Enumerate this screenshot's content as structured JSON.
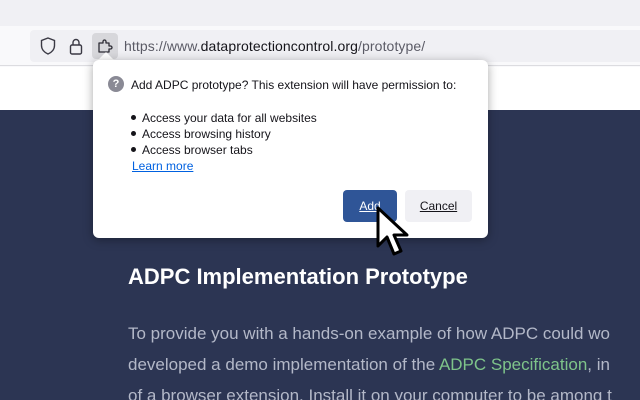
{
  "browser": {
    "url_scheme": "https://www.",
    "url_host": "dataprotectioncontrol.org",
    "url_path": "/prototype/"
  },
  "page": {
    "heading": "ADPC Implementation Prototype",
    "paragraph": {
      "line1": "To provide you with a hands-on example of how ADPC could wo",
      "line2_before": "developed a demo implementation of the ",
      "line2_link": "ADPC Specification",
      "line2_after": ", in",
      "line3": "of a browser extension. Install it on your computer to be among t"
    }
  },
  "popup": {
    "title": "Add ADPC prototype? This extension will have permission to:",
    "permissions": [
      "Access your data for all websites",
      "Access browsing history",
      "Access browser tabs"
    ],
    "learn_more": "Learn more",
    "add_label": "Add",
    "cancel_label": "Cancel"
  },
  "icons": {
    "shield": "shield-icon",
    "lock": "lock-icon",
    "extension": "puzzle-piece-icon",
    "help": "question-mark-icon",
    "cursor": "mouse-pointer-icon"
  }
}
